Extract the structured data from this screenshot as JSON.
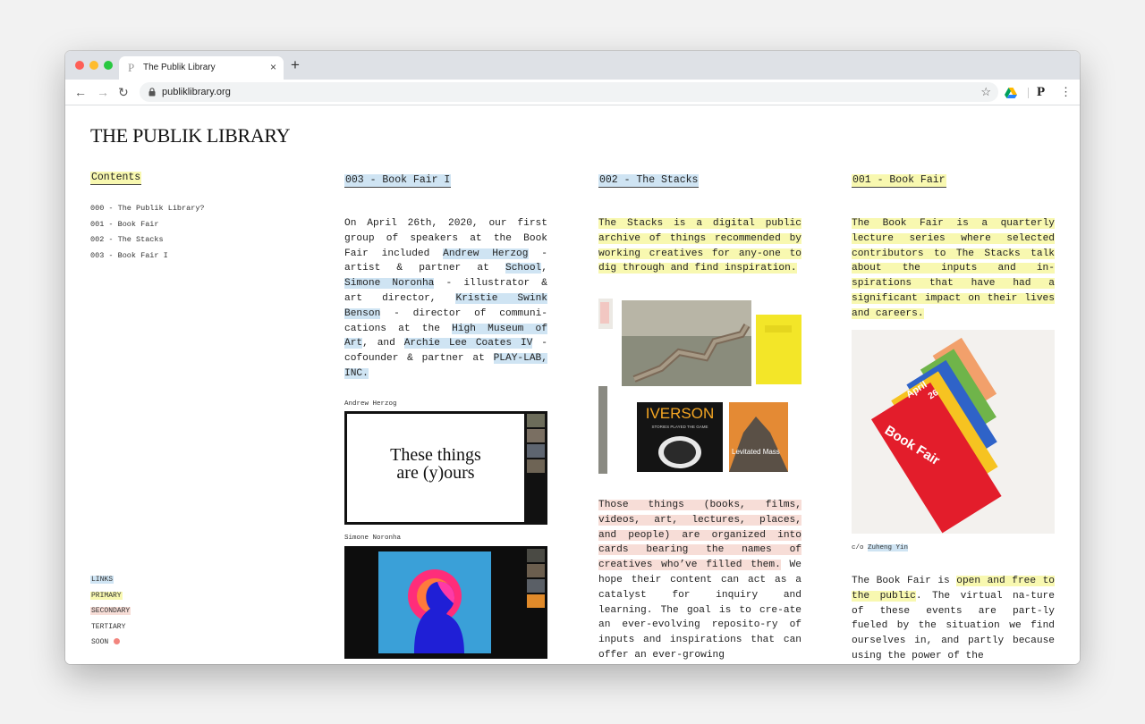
{
  "browser": {
    "tab_title": "The Publik Library",
    "tab_favicon": "P",
    "close_glyph": "×",
    "newtab_glyph": "+",
    "back_glyph": "←",
    "forward_glyph": "→",
    "reload_glyph": "↻",
    "url": "publiklibrary.org",
    "star_glyph": "☆",
    "profile_letter": "P",
    "menu_glyph": "⋮"
  },
  "site": {
    "title": "THE PUBLIK LIBRARY",
    "contents_heading": "Contents",
    "toc": [
      "000 - The Publik Library?",
      "001 - Book Fair",
      "002 - The Stacks",
      "003 - Book Fair I"
    ],
    "legend": {
      "links": "LINKS",
      "primary": "PRIMARY",
      "secondary": "SECONDARY",
      "tertiary": "TERTIARY",
      "soon": "SOON"
    }
  },
  "colors": {
    "link_highlight": "#cfe4f3",
    "primary_highlight": "#f8f8b0",
    "secondary_highlight": "#f7ddd7",
    "soon_dot": "#f2857e"
  },
  "col1": {
    "heading": "003 - Book Fair I",
    "para": [
      {
        "t": "On April 26th, 2020, our first group of speakers at the Book Fair included ",
        "c": ""
      },
      {
        "t": "Andrew Herzog",
        "c": "link"
      },
      {
        "t": " - artist & partner at ",
        "c": ""
      },
      {
        "t": "School",
        "c": "link"
      },
      {
        "t": ", ",
        "c": ""
      },
      {
        "t": "Simone Noronha",
        "c": "link"
      },
      {
        "t": " - illustrator & art director, ",
        "c": ""
      },
      {
        "t": "Kristie Swink Benson",
        "c": "link"
      },
      {
        "t": " - director of communi-cations at the ",
        "c": ""
      },
      {
        "t": "High Museum of Art",
        "c": "link"
      },
      {
        "t": ", and ",
        "c": ""
      },
      {
        "t": "Archie Lee Coates IV",
        "c": "link"
      },
      {
        "t": " - cofounder & partner at ",
        "c": ""
      },
      {
        "t": "PLAY-LAB, INC.",
        "c": "link"
      }
    ],
    "caption1": "Andrew Herzog",
    "slide_line1": "These things",
    "slide_line2": "are (y)ours",
    "caption2": "Simone Noronha"
  },
  "col2": {
    "heading": "002 - The Stacks",
    "para1": [
      {
        "t": "The Stacks is a digital public archive of things recommended by working creatives for any-one to dig through and find inspiration.",
        "c": "primary"
      }
    ],
    "collage": {
      "book1_title": "IVERSON",
      "book1_subtitle": "STORIES PLAYED THE GAME",
      "book2_title": "Levitated Mass"
    },
    "para2": [
      {
        "t": "Those things (books, films, videos, art, lectures, places, and people) are organized into cards bearing the names of creatives who’ve filled them.",
        "c": "secondary"
      },
      {
        "t": " We hope their content can act as a catalyst for inquiry and learning. The goal is to cre-ate an ever-evolving reposito-ry of inputs and inspirations that can offer an ever-growing",
        "c": ""
      }
    ]
  },
  "col3": {
    "heading": "001 - Book Fair",
    "para1": [
      {
        "t": "The Book Fair is a quarterly lecture series where selected contributors to The Stacks talk about the inputs and in-spirations that have had a significant impact on their lives and careers.",
        "c": "primary"
      }
    ],
    "bookfair_image": {
      "cover_text": "Book Fair",
      "month": "April",
      "day": "26"
    },
    "credit_prefix": "c/o ",
    "credit_name": "Zuheng Yin",
    "para2": [
      {
        "t": "The Book Fair is ",
        "c": ""
      },
      {
        "t": "open and free to the public",
        "c": "primary"
      },
      {
        "t": ". The virtual na-ture of these events are part-ly fueled by the situation we find ourselves in, and partly because using the power of the",
        "c": ""
      }
    ]
  }
}
